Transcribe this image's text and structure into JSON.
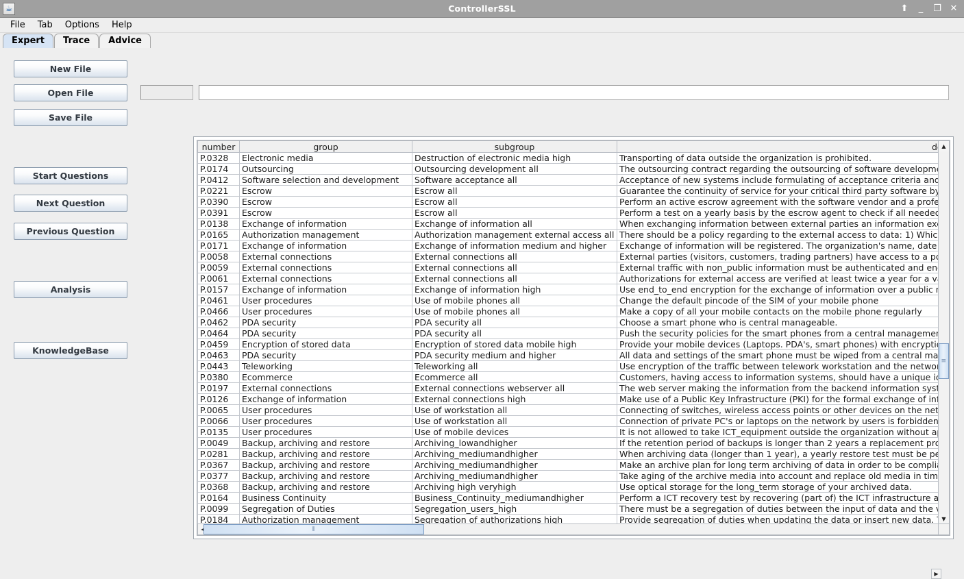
{
  "window": {
    "title": "ControllerSSL",
    "icon": "java-coffee-icon",
    "controls": [
      {
        "name": "shade-button",
        "glyph": "⬆"
      },
      {
        "name": "minimize-button",
        "glyph": "_"
      },
      {
        "name": "maximize-button",
        "glyph": "❐"
      },
      {
        "name": "close-button",
        "glyph": "✕"
      }
    ]
  },
  "menubar": {
    "items": [
      {
        "label": "File"
      },
      {
        "label": "Tab"
      },
      {
        "label": "Options"
      },
      {
        "label": "Help"
      }
    ]
  },
  "tabs": [
    {
      "label": "Expert",
      "selected": true
    },
    {
      "label": "Trace",
      "selected": false
    },
    {
      "label": "Advice",
      "selected": false
    }
  ],
  "buttons": [
    {
      "label": "New File",
      "name": "new-file-button"
    },
    {
      "label": "Open File",
      "name": "open-file-button"
    },
    {
      "label": "Save File",
      "name": "save-file-button"
    },
    {
      "label": "Start Questions",
      "name": "start-questions-button"
    },
    {
      "label": "Next Question",
      "name": "next-question-button"
    },
    {
      "label": "Previous Question",
      "name": "previous-question-button"
    },
    {
      "label": "Analysis",
      "name": "analysis-button"
    },
    {
      "label": "KnowledgeBase",
      "name": "knowledgebase-button"
    }
  ],
  "fields": {
    "small": {
      "value": "",
      "placeholder": ""
    },
    "large": {
      "value": "",
      "placeholder": ""
    }
  },
  "table": {
    "columns": [
      "number",
      "group",
      "subgroup",
      "description"
    ],
    "rows": [
      [
        "P.0328",
        "Electronic media",
        "Destruction of electronic media high",
        "Transporting of data outside the organization is prohibited."
      ],
      [
        "P.0174",
        "Outsourcing",
        "Outsourcing development all",
        "The outsourcing contract regarding the outsourcing of software developme"
      ],
      [
        "P.0412",
        "Software selection and development",
        "Software acceptance all",
        "Acceptance of new systems include formulating of acceptance criteria and"
      ],
      [
        "P.0221",
        "Escrow",
        "Escrow all",
        "Guarantee the continuity of service for your critical third party software by a"
      ],
      [
        "P.0390",
        "Escrow",
        "Escrow all",
        "Perform an active escrow agreement with the software vendor and a profes"
      ],
      [
        "P.0391",
        "Escrow",
        "Escrow all",
        "Perform a test on a yearly basis by the escrow agent to check if all needed"
      ],
      [
        "P.0138",
        "Exchange of information",
        "Exchange of information all",
        "When exchanging information between external parties an information exch"
      ],
      [
        "P.0165",
        "Authorization management",
        "Authorization management external access all",
        "There should be a policy regarding to the  external access to data: 1) Whic"
      ],
      [
        "P.0171",
        "Exchange of information",
        "Exchange of information medium and higher",
        "Exchange of information will be registered. The organization's name, date o"
      ],
      [
        "P.0058",
        "External connections",
        "External connections all",
        "External parties (visitors, customers, trading partners) have access to a po"
      ],
      [
        "P.0059",
        "External connections",
        "External connections all",
        "External traffic with non_public information must be authenticated and encr"
      ],
      [
        "P.0061",
        "External connections",
        "External connections all",
        "Authorizations for external access are verified at least twice a year for a val"
      ],
      [
        "P.0157",
        "Exchange of information",
        "Exchange of information high",
        "Use end_to_end encryption for the exchange of information over a public ne"
      ],
      [
        "P.0461",
        "User procedures",
        "Use of mobile phones all",
        "Change the default pincode of the SIM of your mobile phone"
      ],
      [
        "P.0466",
        "User procedures",
        "Use of mobile phones all",
        "Make a copy of all your mobile contacts on the mobile phone regularly"
      ],
      [
        "P.0462",
        "PDA security",
        "PDA security all",
        "Choose a smart phone who is central manageable."
      ],
      [
        "P.0464",
        "PDA security",
        "PDA security all",
        "Push the security policies for the smart phones from a central managemen"
      ],
      [
        "P.0459",
        "Encryption of stored data",
        "Encryption of stored data mobile high",
        "Provide your mobile devices (Laptops. PDA's, smart phones) with encryption"
      ],
      [
        "P.0463",
        "PDA security",
        "PDA security medium and higher",
        "All data and settings of the smart phone must be wiped from a central man"
      ],
      [
        "P.0443",
        "Teleworking",
        "Teleworking all",
        "Use encryption of the traffic between telework workstation and the network"
      ],
      [
        "P.0380",
        "Ecommerce",
        "Ecommerce all",
        "Customers, having access to information systems, should have a unique ide"
      ],
      [
        "P.0197",
        "External connections",
        "External connections webserver all",
        "The web server making the information from the backend information syste"
      ],
      [
        "P.0126",
        "Exchange of information",
        "External connections high",
        "Make use of a Public Key Infrastructure (PKI) for the formal exchange of info"
      ],
      [
        "P.0065",
        "User procedures",
        "Use of workstation all",
        "Connecting of switches, wireless access points or other devices on the net"
      ],
      [
        "P.0066",
        "User procedures",
        "Use of workstation all",
        "Connection of private PC's or laptops on the network by users is forbidden."
      ],
      [
        "P.0135",
        "User procedures",
        "Use of mobile devices",
        "It is not allowed to take ICT_equipment outside the organization without ap"
      ],
      [
        "P.0049",
        "Backup, archiving and restore",
        "Archiving_lowandhigher",
        "If the retention period of backups is longer than 2 years a replacement pro"
      ],
      [
        "P.0281",
        "Backup, archiving and restore",
        "Archiving_mediumandhigher",
        "When archiving data (longer than 1 year), a yearly restore test must be per"
      ],
      [
        "P.0367",
        "Backup, archiving and restore",
        "Archiving_mediumandhigher",
        "Make an archive plan for long term archiving of data in order to be complian"
      ],
      [
        "P.0377",
        "Backup, archiving and restore",
        "Archiving_mediumandhigher",
        "Take aging of the archive media into account and replace old media in time"
      ],
      [
        "P.0368",
        "Backup, archiving and restore",
        "Archiving high veryhigh",
        "Use optical storage for the long_term storage of your archived data."
      ],
      [
        "P.0164",
        "Business Continuity",
        "Business_Continuity_mediumandhigher",
        "Perform a ICT recovery test by recovering (part of) the ICT infrastructure an"
      ],
      [
        "P.0099",
        "Segregation of Duties",
        "Segregation_users_high",
        "There must be a segregation of duties between the input of data and the v"
      ],
      [
        "P.0184",
        "Authorization management",
        "Segregation of authorizations high",
        "Provide segregation of duties when updating the data or insert new data. T"
      ]
    ]
  },
  "scrollbars": {
    "vertical": {
      "up_glyph": "▲",
      "down_glyph": "▼",
      "grip": "≡"
    },
    "horizontal": {
      "left_glyph": "◀",
      "right_glyph": "▶",
      "grip": "⦀"
    }
  }
}
